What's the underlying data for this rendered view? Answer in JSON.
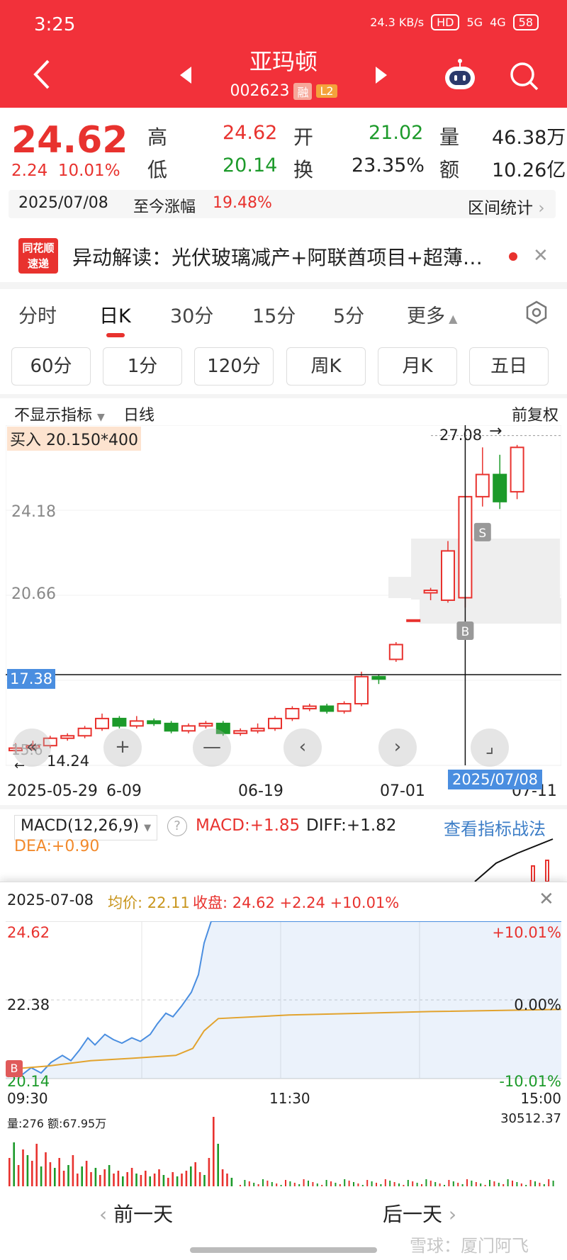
{
  "status": {
    "time": "3:25",
    "net": "24.3 KB/s",
    "hd": "HD",
    "sig5g": "5G",
    "sig4g": "4G",
    "battery": "58"
  },
  "stock": {
    "name": "亚玛顿",
    "code": "002623",
    "tag_margin": "融",
    "tag_level": "L2"
  },
  "quote": {
    "price": "24.62",
    "change": "2.24",
    "change_pct": "10.01%",
    "high_label": "高",
    "high": "24.62",
    "open_label": "开",
    "open": "21.02",
    "volume_label": "量",
    "volume": "46.38万",
    "low_label": "低",
    "low": "20.14",
    "turnover_label": "换",
    "turnover": "23.35%",
    "amount_label": "额",
    "amount": "10.26亿",
    "date": "2025/07/08",
    "gain_label": "至今涨幅",
    "gain": "19.48%",
    "interval_stats": "区间统计"
  },
  "news": {
    "logo_line1": "同花顺",
    "logo_line2": "速递",
    "text": "异动解读：光伏玻璃减产+阿联酋项目+超薄…"
  },
  "tabs": [
    "分时",
    "日K",
    "30分",
    "15分",
    "5分",
    "更多"
  ],
  "chips": [
    "60分",
    "1分",
    "120分",
    "周K",
    "月K",
    "五日"
  ],
  "kline": {
    "indicator": "不显示指标",
    "period": "日线",
    "adjust": "前复权",
    "buy_info": "买入 20.150*400",
    "y_labels": {
      "top": "27.08",
      "a": "24.18",
      "b": "20.66"
    },
    "cross_price": "17.38",
    "low_label": "14.24",
    "low_partial": "15.6",
    "dates": [
      "2025-05-29",
      "6-09",
      "06-19",
      "07-01",
      "07-11"
    ],
    "cross_date": "2025/07/08",
    "marks": {
      "s": "S",
      "b": "B"
    },
    "candles": [
      {
        "o": 14.3,
        "c": 14.4,
        "h": 14.6,
        "l": 14.2
      },
      {
        "o": 14.4,
        "c": 14.5,
        "h": 14.7,
        "l": 14.3
      },
      {
        "o": 14.5,
        "c": 14.8,
        "h": 14.9,
        "l": 14.4
      },
      {
        "o": 14.8,
        "c": 14.9,
        "h": 15.0,
        "l": 14.7
      },
      {
        "o": 14.9,
        "c": 15.2,
        "h": 15.3,
        "l": 14.8
      },
      {
        "o": 15.2,
        "c": 15.6,
        "h": 15.8,
        "l": 15.1
      },
      {
        "o": 15.6,
        "c": 15.3,
        "h": 15.7,
        "l": 15.2
      },
      {
        "o": 15.3,
        "c": 15.5,
        "h": 15.7,
        "l": 15.2
      },
      {
        "o": 15.5,
        "c": 15.4,
        "h": 15.6,
        "l": 15.3
      },
      {
        "o": 15.4,
        "c": 15.1,
        "h": 15.5,
        "l": 15.0
      },
      {
        "o": 15.1,
        "c": 15.3,
        "h": 15.4,
        "l": 15.0
      },
      {
        "o": 15.3,
        "c": 15.4,
        "h": 15.5,
        "l": 15.2
      },
      {
        "o": 15.4,
        "c": 15.0,
        "h": 15.5,
        "l": 14.9
      },
      {
        "o": 15.0,
        "c": 15.1,
        "h": 15.2,
        "l": 14.9
      },
      {
        "o": 15.1,
        "c": 15.2,
        "h": 15.4,
        "l": 15.0
      },
      {
        "o": 15.2,
        "c": 15.6,
        "h": 15.7,
        "l": 15.1
      },
      {
        "o": 15.6,
        "c": 16.0,
        "h": 16.1,
        "l": 15.5
      },
      {
        "o": 16.0,
        "c": 16.1,
        "h": 16.2,
        "l": 15.9
      },
      {
        "o": 16.1,
        "c": 15.9,
        "h": 16.2,
        "l": 15.8
      },
      {
        "o": 15.9,
        "c": 16.2,
        "h": 16.3,
        "l": 15.8
      },
      {
        "o": 16.2,
        "c": 17.3,
        "h": 17.5,
        "l": 16.1
      },
      {
        "o": 17.3,
        "c": 17.2,
        "h": 17.4,
        "l": 17.0
      },
      {
        "o": 18.0,
        "c": 18.6,
        "h": 18.7,
        "l": 17.9
      },
      {
        "o": 19.6,
        "c": 19.6,
        "h": 19.6,
        "l": 19.6
      },
      {
        "o": 20.7,
        "c": 20.8,
        "h": 20.9,
        "l": 20.4
      },
      {
        "o": 20.4,
        "c": 22.4,
        "h": 22.8,
        "l": 20.3
      },
      {
        "o": 20.5,
        "c": 24.6,
        "h": 24.6,
        "l": 20.1
      },
      {
        "o": 24.6,
        "c": 25.5,
        "h": 26.6,
        "l": 24.2
      },
      {
        "o": 25.5,
        "c": 24.4,
        "h": 26.3,
        "l": 24.1
      },
      {
        "o": 24.8,
        "c": 26.6,
        "h": 26.7,
        "l": 24.5
      }
    ]
  },
  "macd": {
    "select": "MACD(12,26,9)",
    "macd": "MACD:+1.85",
    "diff": "DIFF:+1.82",
    "dea": "DEA:+0.90",
    "link": "查看指标战法"
  },
  "intraday": {
    "date": "2025-07-08",
    "avg": "均价: 22.11",
    "close": "收盘: 24.62 +2.24 +10.01%",
    "y_top": "24.62",
    "y_mid": "22.38",
    "y_bot": "20.14",
    "r_top": "+10.01%",
    "r_mid": "0.00%",
    "r_bot": "-10.01%",
    "b_mark": "B",
    "t_start": "09:30",
    "t_mid": "11:30",
    "t_end": "15:00",
    "vol_info": "量:276   额:67.95万",
    "vol_max": "30512.37",
    "prev_day": "前一天",
    "next_day": "后一天"
  },
  "watermark": "雪球：厦门阿飞",
  "colors": {
    "brand": "#f2313a",
    "up": "#e8322e",
    "down": "#1c9a2a",
    "link": "#3d7ec7"
  }
}
